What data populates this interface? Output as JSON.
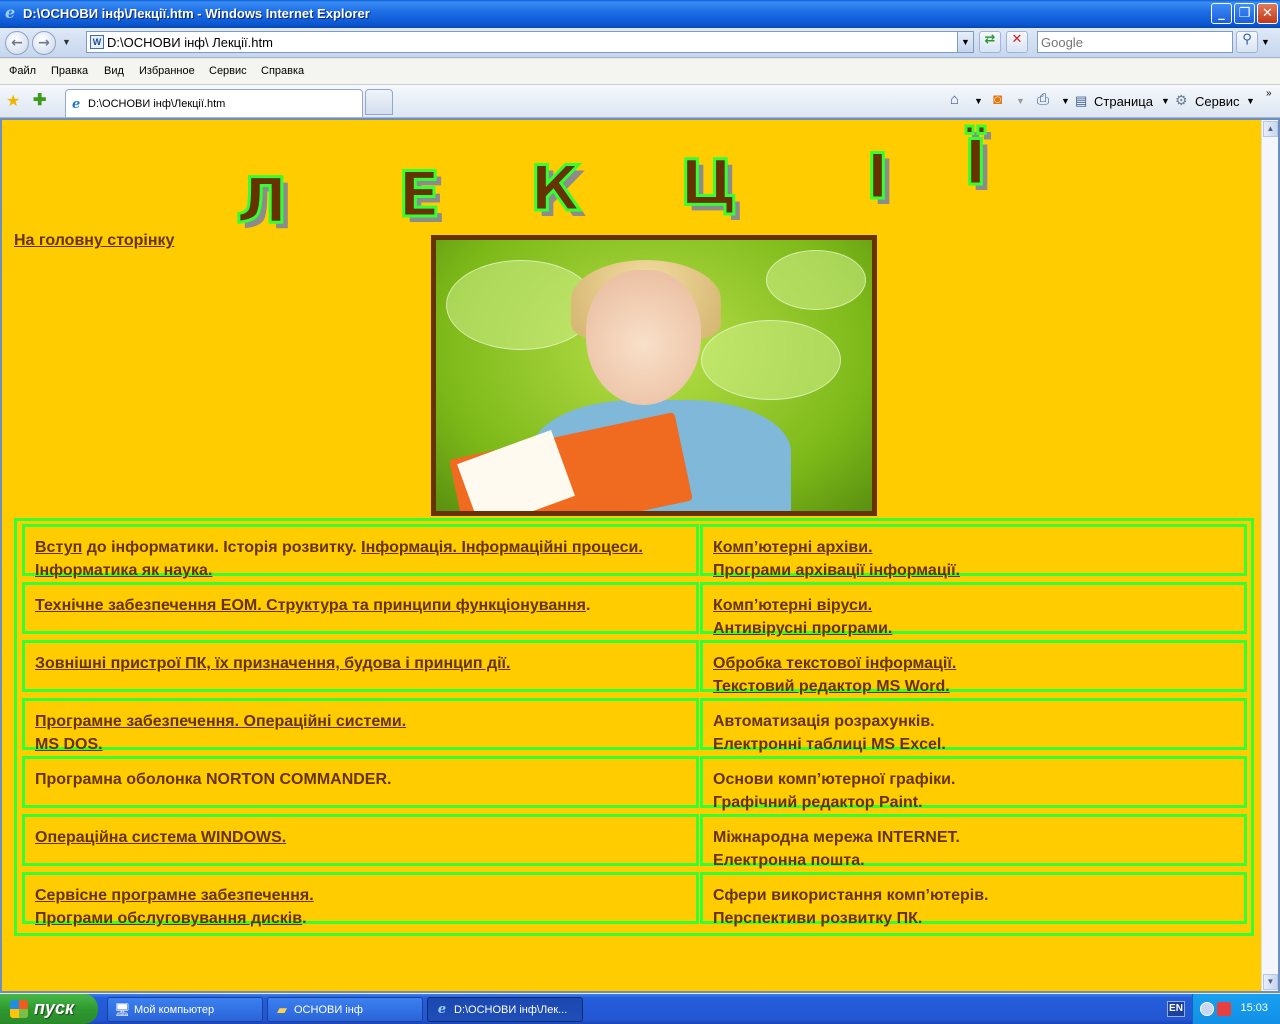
{
  "window": {
    "title": "D:\\ОСНОВИ інф\\Лекції.htm - Windows Internet Explorer"
  },
  "address_bar": {
    "url": "D:\\ОСНОВИ інф\\ Лекції.htm",
    "search_placeholder": "Google"
  },
  "menu": [
    "Файл",
    "Правка",
    "Вид",
    "Избранное",
    "Сервис",
    "Справка"
  ],
  "tab": {
    "label": "D:\\ОСНОВИ інф\\Лекції.htm"
  },
  "command_bar": {
    "page_label": "Страница",
    "tools_label": "Сервис"
  },
  "page": {
    "heading_letters": [
      "Л",
      "Е",
      "К",
      "Ц",
      "І",
      "Ї"
    ],
    "home_link": "На  головну сторінку",
    "lectures": [
      {
        "left": [
          {
            "text": "Вступ",
            "link": true
          },
          {
            "text": " до інформатики. Історія розвитку. ",
            "link": false
          },
          {
            "text": "Інформація. Інформаційні процеси. Інформатика як наука.",
            "link": true
          }
        ],
        "right": [
          {
            "text": "Комп’ютерні архіви.",
            "link": true,
            "br": true
          },
          {
            "text": "Програми архівації інформації.",
            "link": true
          }
        ]
      },
      {
        "left": [
          {
            "text": "Технічне забезпечення ЕОМ. Структура та принципи функціонування",
            "link": true
          },
          {
            "text": ".",
            "link": false
          }
        ],
        "right": [
          {
            "text": "Комп’ютерні віруси.",
            "link": true,
            "br": true
          },
          {
            "text": "Антивірусні програми.",
            "link": true
          }
        ]
      },
      {
        "left": [
          {
            "text": "Зовнішні пристрої ПК, їх призначення, будова і принцип дії.",
            "link": true
          }
        ],
        "right": [
          {
            "text": "Обробка текстової інформації.",
            "link": true,
            "br": true
          },
          {
            "text": " Текстовий редактор MS Word.",
            "link": true
          }
        ]
      },
      {
        "left": [
          {
            "text": "Програмне забезпечення. Операційні системи.",
            "link": true,
            "br": true
          },
          {
            "text": "MS DOS.",
            "link": true
          }
        ],
        "right": [
          {
            "text": "Автоматизація розрахунків.",
            "link": false,
            "br": true
          },
          {
            "text": "Електронні таблиці MS Excel.",
            "link": false
          }
        ]
      },
      {
        "left": [
          {
            "text": "Програмна оболонка NORTON COMMANDER.",
            "link": false
          }
        ],
        "right": [
          {
            "text": "Основи комп’ютерної графіки.",
            "link": false,
            "br": true
          },
          {
            "text": "Графічний редактор Paint.",
            "link": false
          }
        ]
      },
      {
        "left": [
          {
            "text": "Операційна система WINDOWS.",
            "link": true
          }
        ],
        "right": [
          {
            "text": "Міжнародна мережа INTERNET.",
            "link": false,
            "br": true
          },
          {
            "text": "Електронна пошта.",
            "link": false
          }
        ]
      },
      {
        "left": [
          {
            "text": "Сервісне програмне забезпечення.",
            "link": true,
            "br": true
          },
          {
            "text": "Програми обслуговування дисків",
            "link": true
          },
          {
            "text": ".",
            "link": false
          }
        ],
        "right": [
          {
            "text": "Сфери використання комп’ютерів.",
            "link": false,
            "br": true
          },
          {
            "text": "Перспективи розвитку ПК.",
            "link": false
          }
        ]
      }
    ]
  },
  "taskbar": {
    "start_label": "пуск",
    "tasks": [
      "Мой компьютер",
      "ОСНОВИ інф",
      "D:\\ОСНОВИ інф\\Лек..."
    ],
    "language": "EN",
    "clock": "15:03"
  },
  "colors": {
    "page_background": "#ffcc00",
    "link_text": "#663300",
    "table_border": "#33ff33"
  }
}
